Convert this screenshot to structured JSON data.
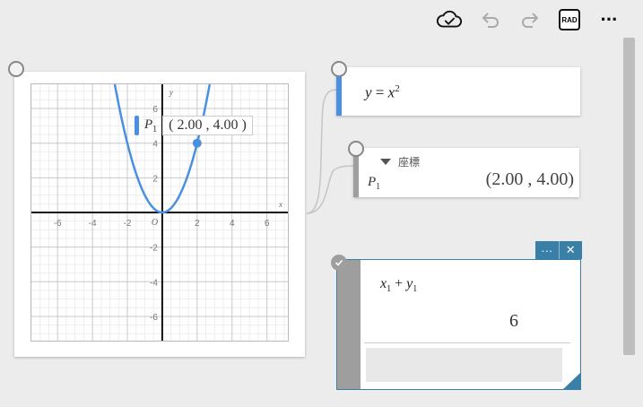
{
  "toolbar": {
    "icons": [
      "cloud-check-icon",
      "undo-icon",
      "redo-icon",
      "angle-mode-button",
      "more-icon"
    ],
    "angle_mode": "RAD",
    "more": "···"
  },
  "graph": {
    "x_axis_label": "x",
    "y_axis_label": "y",
    "origin_label": "O",
    "x_tick_labels": [
      "-6",
      "-4",
      "-2",
      "2",
      "4",
      "6"
    ],
    "y_tick_labels": [
      "6",
      "4",
      "2",
      "-2",
      "-4",
      "-6"
    ],
    "xlim": [
      -7.5,
      7.2
    ],
    "ylim": [
      -7.4,
      7.4
    ],
    "curve_color": "#4a90e2",
    "point": {
      "name": "P",
      "subscript": "1",
      "x": 2,
      "y": 4,
      "label": "( 2.00 , 4.00 )"
    }
  },
  "function_card": {
    "lhs": "y",
    "eq": " = ",
    "base": "x",
    "exponent": "2",
    "accent": "#4a90e2"
  },
  "coordinate_card": {
    "title": "座標",
    "point_name": "P",
    "point_sub": "1",
    "value": "(2.00 , 4.00)"
  },
  "calc_card": {
    "term1": "x",
    "term1_sub": "1",
    "op": " + ",
    "term2": "y",
    "term2_sub": "1",
    "result": "6",
    "input_value": "",
    "tab_more": "···",
    "tab_close": "✕",
    "accent": "#3a7fa8"
  }
}
